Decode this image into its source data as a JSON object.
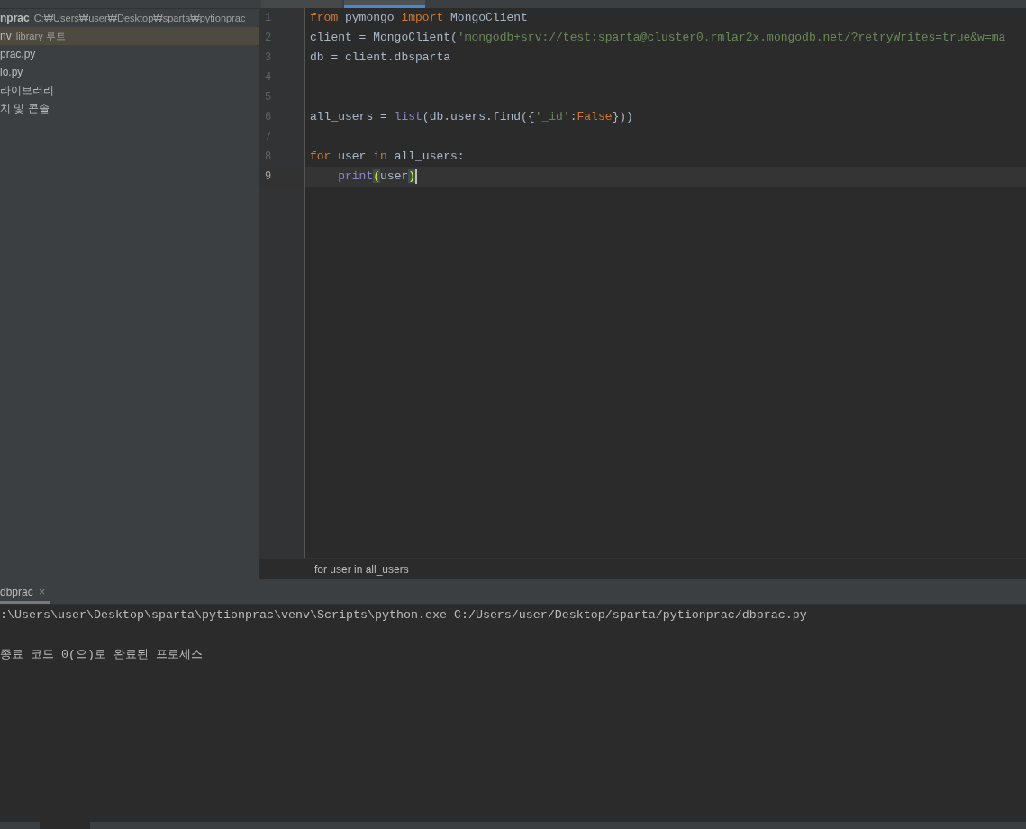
{
  "project_tree": {
    "items": [
      {
        "kind": "root",
        "label": "nprac",
        "path": "C:₩Users₩user₩Desktop₩sparta₩pytionprac",
        "selected": false
      },
      {
        "kind": "folder",
        "label": "nv",
        "note": "library 루트",
        "selected": true
      },
      {
        "kind": "file",
        "label": "prac.py",
        "selected": false
      },
      {
        "kind": "file",
        "label": "lo.py",
        "selected": false
      },
      {
        "kind": "file",
        "label": "라이브러리",
        "selected": false
      },
      {
        "kind": "file",
        "label": "치 및 콘솔",
        "selected": false
      }
    ]
  },
  "editor": {
    "tabs": [
      {
        "selected": false
      },
      {
        "selected": true
      }
    ],
    "lines": [
      {
        "number": "1",
        "current": false,
        "tokens": [
          {
            "kind": "keyword",
            "text": "from"
          },
          {
            "kind": "plain",
            "text": " pymongo "
          },
          {
            "kind": "keyword",
            "text": "import"
          },
          {
            "kind": "plain",
            "text": " MongoClient"
          }
        ]
      },
      {
        "number": "2",
        "current": false,
        "tokens": [
          {
            "kind": "plain",
            "text": "client = MongoClient("
          },
          {
            "kind": "string",
            "text": "'mongodb+srv://test:sparta@cluster0.rmlar2x.mongodb.net/?retryWrites=true&w=ma"
          }
        ]
      },
      {
        "number": "3",
        "current": false,
        "tokens": [
          {
            "kind": "plain",
            "text": "db = client.dbsparta"
          }
        ]
      },
      {
        "number": "4",
        "current": false
      },
      {
        "number": "5",
        "current": false
      },
      {
        "number": "6",
        "current": false,
        "tokens": [
          {
            "kind": "plain",
            "text": "all_users = "
          },
          {
            "kind": "builtin",
            "text": "list"
          },
          {
            "kind": "plain",
            "text": "(db.users.find({"
          },
          {
            "kind": "string",
            "text": "'_id'"
          },
          {
            "kind": "plain",
            "text": ":"
          },
          {
            "kind": "keyword",
            "text": "False"
          },
          {
            "kind": "plain",
            "text": "}))"
          }
        ]
      },
      {
        "number": "7",
        "current": false
      },
      {
        "number": "8",
        "current": false,
        "tokens": [
          {
            "kind": "keyword",
            "text": "for"
          },
          {
            "kind": "plain",
            "text": " user "
          },
          {
            "kind": "keyword",
            "text": "in"
          },
          {
            "kind": "plain",
            "text": " all_users:"
          }
        ]
      },
      {
        "number": "9",
        "current": true,
        "indented": true,
        "tokens": [
          {
            "kind": "builtin",
            "text": "print"
          },
          {
            "kind": "paren",
            "text": "("
          },
          {
            "kind": "plain",
            "text": "user"
          },
          {
            "kind": "paren",
            "text": ")"
          }
        ]
      }
    ],
    "breadcrumb": "for user in all_users"
  },
  "run_console": {
    "tab": {
      "label": "dbprac",
      "close": "×",
      "selected": true
    },
    "lines": [
      {
        "kind": "text",
        "text": ":\\Users\\user\\Desktop\\sparta\\pytionprac\\venv\\Scripts\\python.exe C:/Users/user/Desktop/sparta/pytionprac/dbprac.py"
      },
      {
        "kind": "blank"
      },
      {
        "kind": "text",
        "text": "종료 코드 0(으)로 완료된 프로세스"
      }
    ]
  }
}
